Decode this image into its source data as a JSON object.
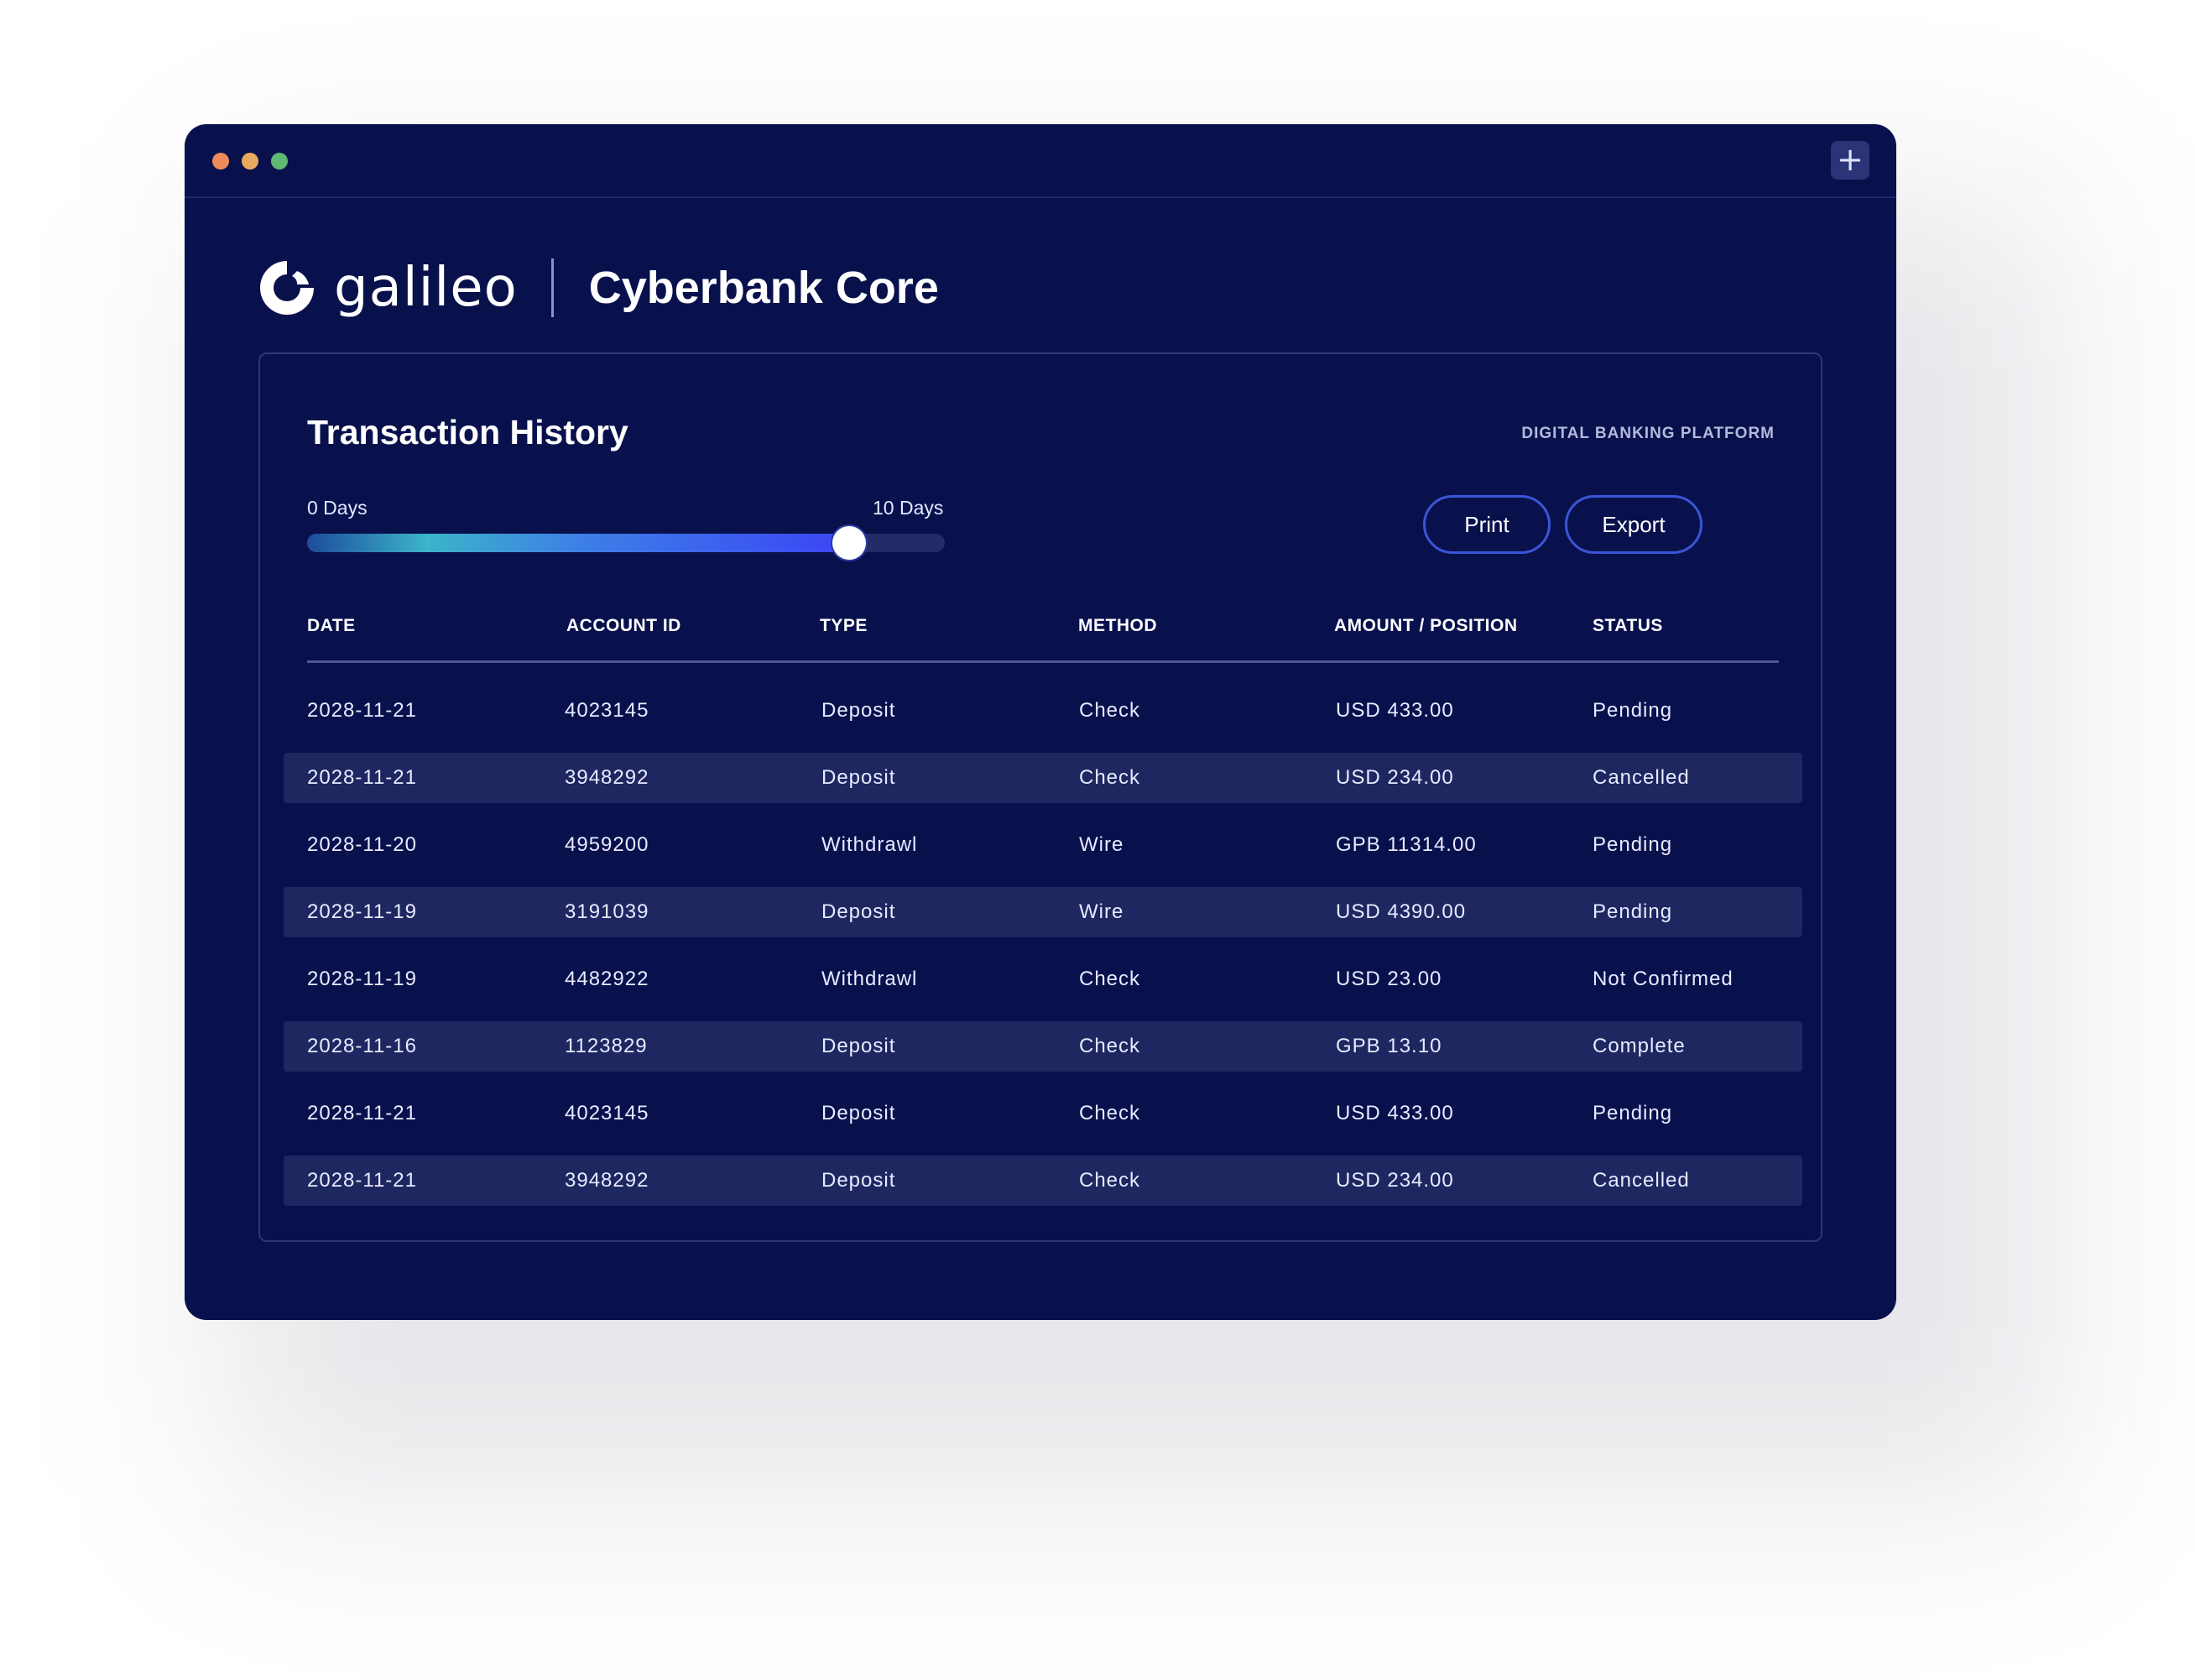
{
  "window": {
    "new_tab_icon": "plus-icon",
    "new_tab_symbol": "+"
  },
  "brand": {
    "logo_icon": "galileo-logo-icon",
    "company": "galileo",
    "product": "Cyberbank Core"
  },
  "panel": {
    "title": "Transaction History",
    "platform_label": "DIGITAL BANKING PLATFORM",
    "range": {
      "min_label": "0 Days",
      "max_label": "10 Days",
      "value_fraction": 0.85
    },
    "buttons": {
      "print": "Print",
      "export": "Export"
    },
    "accent_color": "#3a55d6"
  },
  "table": {
    "columns": [
      "DATE",
      "ACCOUNT ID",
      "TYPE",
      "METHOD",
      "AMOUNT / POSITION",
      "STATUS"
    ],
    "rows": [
      [
        "2028-11-21",
        "4023145",
        "Deposit",
        "Check",
        "USD 433.00",
        "Pending"
      ],
      [
        "2028-11-21",
        "3948292",
        "Deposit",
        "Check",
        "USD 234.00",
        "Cancelled"
      ],
      [
        "2028-11-20",
        "4959200",
        "Withdrawl",
        "Wire",
        "GPB 11314.00",
        "Pending"
      ],
      [
        "2028-11-19",
        "3191039",
        "Deposit",
        "Wire",
        "USD 4390.00",
        "Pending"
      ],
      [
        "2028-11-19",
        "4482922",
        "Withdrawl",
        "Check",
        "USD 23.00",
        "Not Confirmed"
      ],
      [
        "2028-11-16",
        "1123829",
        "Deposit",
        "Check",
        "GPB 13.10",
        "Complete"
      ],
      [
        "2028-11-21",
        "4023145",
        "Deposit",
        "Check",
        "USD 433.00",
        "Pending"
      ],
      [
        "2028-11-21",
        "3948292",
        "Deposit",
        "Check",
        "USD 234.00",
        "Cancelled"
      ]
    ]
  }
}
